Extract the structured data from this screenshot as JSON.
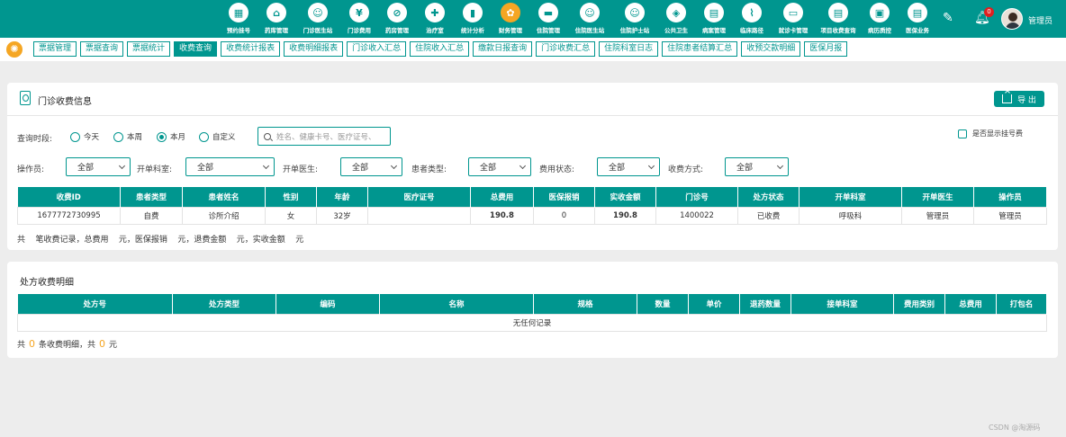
{
  "nav": [
    {
      "label": "预约挂号",
      "icon": "calendar-icon",
      "glyph": "▦"
    },
    {
      "label": "药库管理",
      "icon": "warehouse-icon",
      "glyph": "⌂"
    },
    {
      "label": "门诊医生站",
      "icon": "doctor-icon",
      "glyph": "☺"
    },
    {
      "label": "门诊费用",
      "icon": "yen-icon",
      "glyph": "¥"
    },
    {
      "label": "药房管理",
      "icon": "pill-icon",
      "glyph": "⊘"
    },
    {
      "label": "治疗室",
      "icon": "treatment-icon",
      "glyph": "✚"
    },
    {
      "label": "统计分析",
      "icon": "bar-chart-icon",
      "glyph": "▮"
    },
    {
      "label": "财务管理",
      "icon": "gear-icon",
      "glyph": "✿"
    },
    {
      "label": "住院管理",
      "icon": "bed-icon",
      "glyph": "▬"
    },
    {
      "label": "住院医生站",
      "icon": "doctor-icon",
      "glyph": "☺"
    },
    {
      "label": "住院护士站",
      "icon": "nurse-icon",
      "glyph": "☺"
    },
    {
      "label": "公共卫生",
      "icon": "public-health-icon",
      "glyph": "◈"
    },
    {
      "label": "病案管理",
      "icon": "case-record-icon",
      "glyph": "▤"
    },
    {
      "label": "临床路径",
      "icon": "dna-icon",
      "glyph": "⌇"
    },
    {
      "label": "就诊卡管理",
      "icon": "card-icon",
      "glyph": "▭"
    },
    {
      "label": "项目收费查询",
      "icon": "document-search-icon",
      "glyph": "▤"
    },
    {
      "label": "病历质控",
      "icon": "quality-control-icon",
      "glyph": "▣"
    },
    {
      "label": "医保业务",
      "icon": "insurance-icon",
      "glyph": "▤"
    }
  ],
  "nav_active_index": 7,
  "header": {
    "badge_count": "0",
    "user_name": "管理员"
  },
  "tabs": [
    {
      "label": "票据管理"
    },
    {
      "label": "票据查询"
    },
    {
      "label": "票据统计"
    },
    {
      "label": "收费查询"
    },
    {
      "label": "收费统计报表"
    },
    {
      "label": "收费明细报表"
    },
    {
      "label": "门诊收入汇总"
    },
    {
      "label": "住院收入汇总"
    },
    {
      "label": "缴款日报查询"
    },
    {
      "label": "门诊收费汇总"
    },
    {
      "label": "住院科室日志"
    },
    {
      "label": "住院患者结算汇总"
    },
    {
      "label": "收预交款明细"
    },
    {
      "label": "医保月报"
    }
  ],
  "active_tab_index": 3,
  "card1": {
    "title": "门诊收费信息",
    "export_label": "导 出",
    "query_time_label": "查询时段:",
    "radios": [
      {
        "label": "今天",
        "selected": false
      },
      {
        "label": "本周",
        "selected": false
      },
      {
        "label": "本月",
        "selected": true
      },
      {
        "label": "自定义",
        "selected": false
      }
    ],
    "search_placeholder": "姓名、健康卡号、医疗证号、",
    "show_register_fee_label": "是否显示挂号费",
    "filters": [
      {
        "label": "操作员:",
        "value": "全部"
      },
      {
        "label": "开单科室:",
        "value": "全部"
      },
      {
        "label": "开单医生:",
        "value": "全部"
      },
      {
        "label": "患者类型:",
        "value": "全部"
      },
      {
        "label": "费用状态:",
        "value": "全部"
      },
      {
        "label": "收费方式:",
        "value": "全部"
      }
    ],
    "columns": [
      "收费ID",
      "患者类型",
      "患者姓名",
      "性别",
      "年龄",
      "医疗证号",
      "总费用",
      "医保报销",
      "实收金额",
      "门诊号",
      "处方状态",
      "开单科室",
      "开单医生",
      "操作员"
    ],
    "rows": [
      [
        "1677772730995",
        "自费",
        "诊所介绍",
        "女",
        "32岁",
        "",
        "190.8",
        "0",
        "190.8",
        "1400022",
        "已收费",
        "呼吸科",
        "管理员",
        "管理员"
      ]
    ],
    "summary": "共    笔收费记录，总费用    元，医保报销    元，退费金额    元，实收金额    元"
  },
  "card2": {
    "title": "处方收费明细",
    "columns": [
      "处方号",
      "处方类型",
      "编码",
      "名称",
      "规格",
      "数量",
      "单价",
      "退药数量",
      "接单科室",
      "费用类别",
      "总费用",
      "打包名"
    ],
    "empty_text": "无任何记录",
    "summary_prefix": "共",
    "count": "0",
    "summary_mid": "条收费明细，共",
    "amount": "0",
    "summary_suffix": "元"
  },
  "watermark": "CSDN @淘源码"
}
